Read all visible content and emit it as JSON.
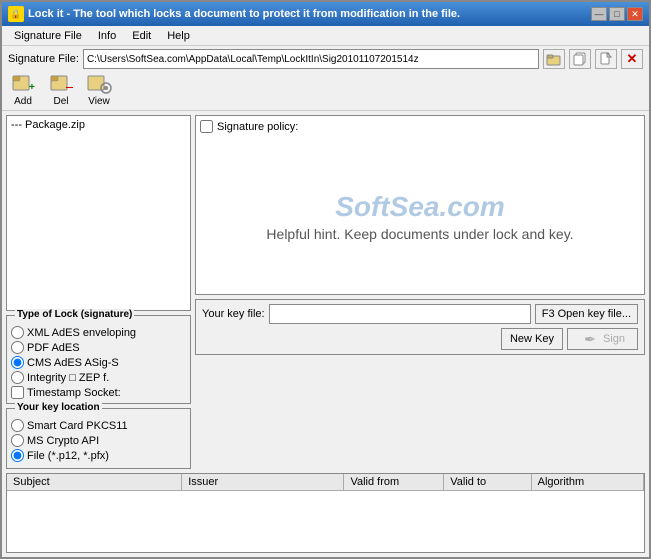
{
  "window": {
    "title": "Lock it - The tool which locks a document to protect it from modification in the file.",
    "icon_label": "🔒"
  },
  "title_buttons": {
    "minimize": "—",
    "maximize": "□",
    "close": "✕"
  },
  "menu": {
    "items": [
      "Signature File",
      "Info",
      "Edit",
      "Help"
    ]
  },
  "toolbar": {
    "sig_file_label": "Signature File:",
    "sig_file_value": "C:\\Users\\SoftSea.com\\AppData\\Local\\Temp\\LockItIn\\Sig20101107201514z",
    "add_label": "Add",
    "del_label": "Del",
    "view_label": "View"
  },
  "file_list": {
    "items": [
      "--- Package.zip"
    ]
  },
  "type_lock": {
    "group_title": "Type of Lock (signature)",
    "options": [
      {
        "label": "XML AdES enveloping",
        "checked": false
      },
      {
        "label": "PDF AdES",
        "checked": false
      },
      {
        "label": "CMS AdES ASig-S",
        "checked": true
      },
      {
        "label": "Integrity  □ ZEP f.",
        "checked": false
      }
    ],
    "timestamp_label": "Timestamp Socket:"
  },
  "signature_panel": {
    "policy_label": "Signature policy:",
    "watermark_line1": "SoftSea.com",
    "hint_text": "Helpful hint. Keep documents under lock and key."
  },
  "key_location": {
    "group_title": "Your key location",
    "options": [
      {
        "label": "Smart Card PKCS11",
        "checked": false
      },
      {
        "label": "MS Crypto API",
        "checked": false
      },
      {
        "label": "File (*.p12, *.pfx)",
        "checked": true
      }
    ]
  },
  "key_file": {
    "label": "Your key file:",
    "value": "",
    "open_btn": "F3 Open key file...",
    "new_key_btn": "New Key",
    "sign_btn": "Sign"
  },
  "cert_table": {
    "headers": [
      "Subject",
      "Issuer",
      "Valid from",
      "Valid to",
      "Algorithm"
    ],
    "rows": []
  }
}
